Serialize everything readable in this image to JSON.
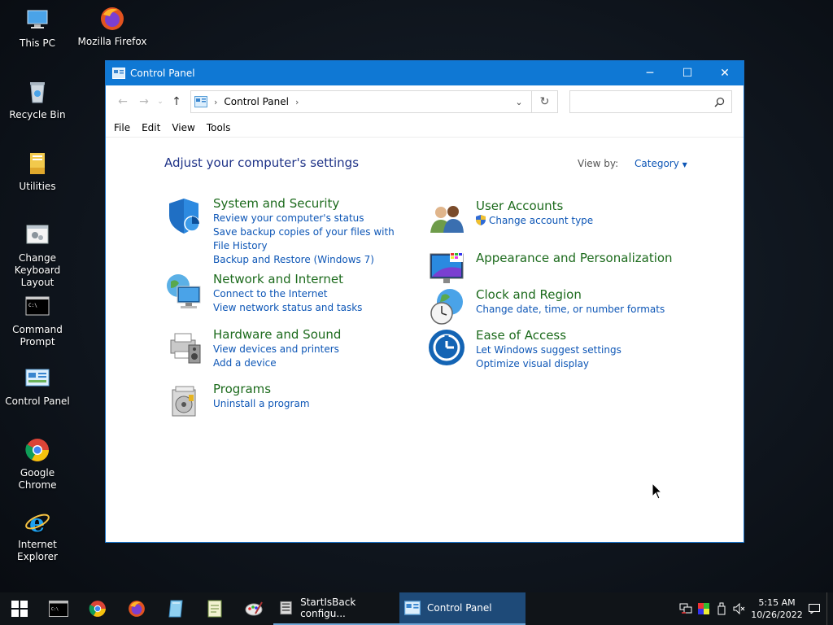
{
  "desktop": {
    "icons": [
      {
        "label": "This PC"
      },
      {
        "label": "Mozilla Firefox"
      },
      {
        "label": "Recycle Bin"
      },
      {
        "label": "Utilities"
      },
      {
        "label": "Change Keyboard Layout"
      },
      {
        "label": "Command Prompt"
      },
      {
        "label": "Control Panel"
      },
      {
        "label": "Google Chrome"
      },
      {
        "label": "Internet Explorer"
      }
    ]
  },
  "window": {
    "title": "Control Panel",
    "address": {
      "crumb": "Control Panel",
      "search_value": ""
    },
    "menu": [
      "File",
      "Edit",
      "View",
      "Tools"
    ],
    "heading": "Adjust your computer's settings",
    "view_by_label": "View by:",
    "view_by_value": "Category",
    "categories": [
      {
        "title": "System and Security",
        "links": [
          "Review your computer's status",
          "Save backup copies of your files with File History",
          "Backup and Restore (Windows 7)"
        ]
      },
      {
        "title": "Network and Internet",
        "links": [
          "Connect to the Internet",
          "View network status and tasks"
        ]
      },
      {
        "title": "Hardware and Sound",
        "links": [
          "View devices and printers",
          "Add a device"
        ]
      },
      {
        "title": "Programs",
        "links": [
          "Uninstall a program"
        ]
      },
      {
        "title": "User Accounts",
        "links": [
          "Change account type"
        ]
      },
      {
        "title": "Appearance and Personalization",
        "links": []
      },
      {
        "title": "Clock and Region",
        "links": [
          "Change date, time, or number formats"
        ]
      },
      {
        "title": "Ease of Access",
        "links": [
          "Let Windows suggest settings",
          "Optimize visual display"
        ]
      }
    ]
  },
  "taskbar": {
    "windows": [
      {
        "label": "StartIsBack configu..."
      },
      {
        "label": "Control Panel"
      }
    ],
    "clock_time": "5:15 AM",
    "clock_date": "10/26/2022"
  },
  "colors": {
    "titlebar": "#0f78d4",
    "link": "#0d56b6",
    "category_title": "#1d6b1d",
    "heading": "#1e3287"
  }
}
